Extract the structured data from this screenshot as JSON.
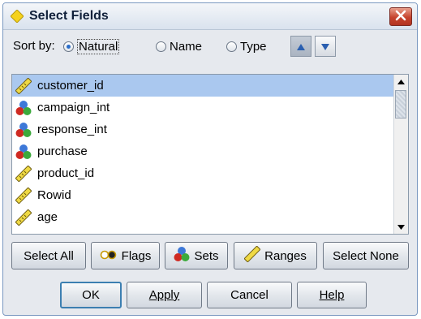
{
  "dialog": {
    "title": "Select Fields"
  },
  "sort": {
    "label": "Sort by:",
    "options": [
      {
        "label": "Natural",
        "selected": true
      },
      {
        "label": "Name",
        "selected": false
      },
      {
        "label": "Type",
        "selected": false
      }
    ],
    "ascending_icon": "sort-ascending-icon",
    "descending_icon": "sort-descending-icon"
  },
  "fields": [
    {
      "name": "customer_id",
      "icon": "range-ruler-icon",
      "selected": true
    },
    {
      "name": "campaign_int",
      "icon": "set-balls-icon",
      "selected": false
    },
    {
      "name": "response_int",
      "icon": "set-balls-icon",
      "selected": false
    },
    {
      "name": "purchase",
      "icon": "set-balls-icon",
      "selected": false
    },
    {
      "name": "product_id",
      "icon": "range-ruler-icon",
      "selected": false
    },
    {
      "name": "Rowid",
      "icon": "range-ruler-icon",
      "selected": false
    },
    {
      "name": "age",
      "icon": "range-ruler-icon",
      "selected": false
    }
  ],
  "filter_buttons": {
    "select_all": "Select All",
    "flags": "Flags",
    "sets": "Sets",
    "ranges": "Ranges",
    "select_none": "Select None"
  },
  "actions": {
    "ok": "OK",
    "apply": "Apply",
    "cancel": "Cancel",
    "help": "Help"
  },
  "colors": {
    "selection": "#aac8ef",
    "close_button": "#c6432d",
    "default_border": "#3c7fb1"
  }
}
